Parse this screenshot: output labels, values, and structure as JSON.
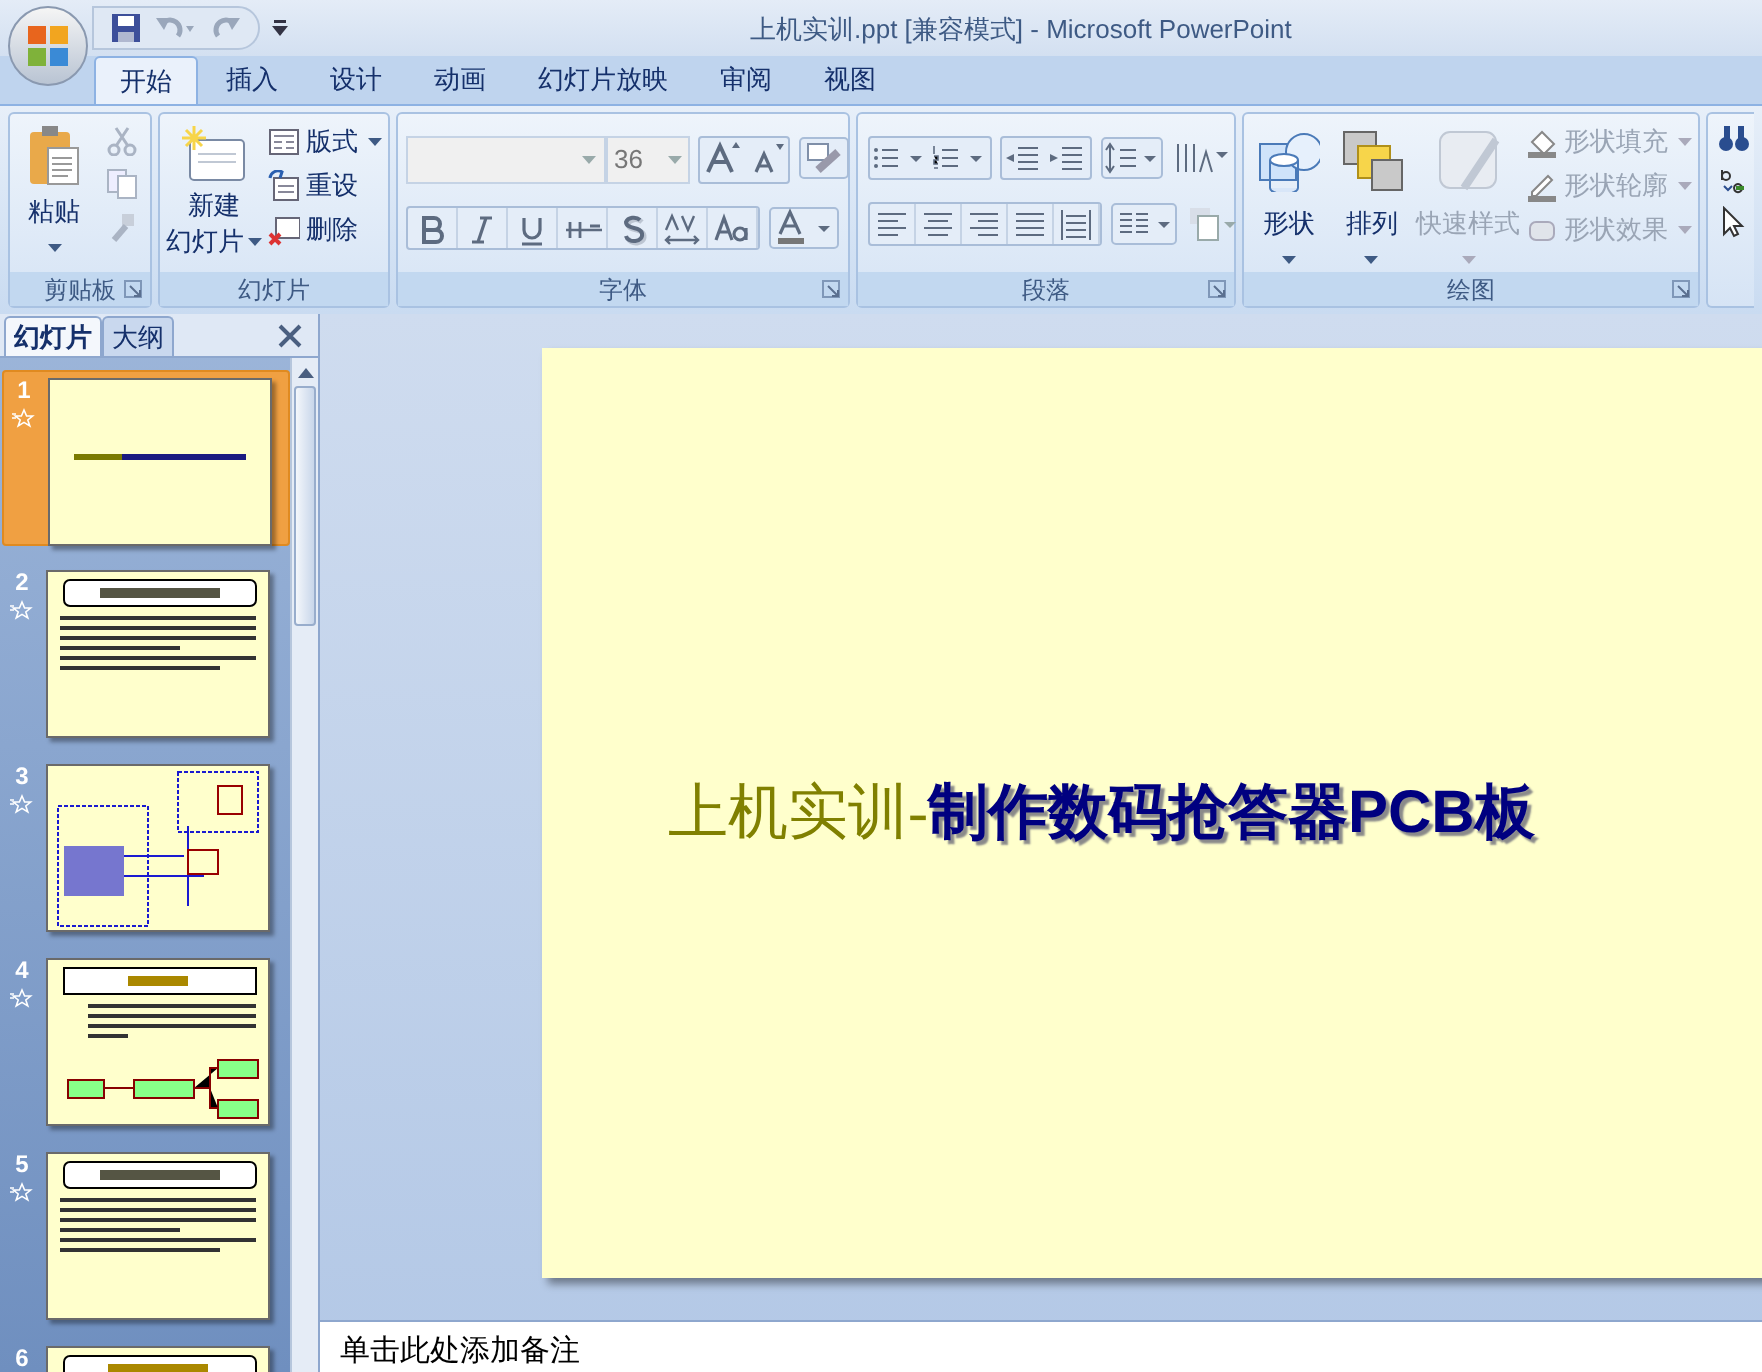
{
  "window": {
    "title": "上机实训.ppt [兼容模式] - Microsoft PowerPoint"
  },
  "tabs": [
    {
      "label": "开始",
      "selected": true
    },
    {
      "label": "插入",
      "selected": false
    },
    {
      "label": "设计",
      "selected": false
    },
    {
      "label": "动画",
      "selected": false
    },
    {
      "label": "幻灯片放映",
      "selected": false
    },
    {
      "label": "审阅",
      "selected": false
    },
    {
      "label": "视图",
      "selected": false
    }
  ],
  "ribbon": {
    "clipboard": {
      "label": "剪贴板",
      "paste": "粘贴"
    },
    "slides": {
      "label": "幻灯片",
      "new_slide": [
        "新建",
        "幻灯片"
      ],
      "items": [
        {
          "label": "版式",
          "dropdown": true
        },
        {
          "label": "重设",
          "dropdown": false
        },
        {
          "label": "删除",
          "dropdown": false
        }
      ]
    },
    "font": {
      "label": "字体",
      "size": "36"
    },
    "paragraph": {
      "label": "段落"
    },
    "drawing": {
      "label": "绘图",
      "big": [
        {
          "label": "形状",
          "disabled": false
        },
        {
          "label": "排列",
          "disabled": false
        },
        {
          "label": "快速样式",
          "disabled": true
        }
      ],
      "items": [
        {
          "label": "形状填充",
          "disabled": true
        },
        {
          "label": "形状轮廓",
          "disabled": true
        },
        {
          "label": "形状效果",
          "disabled": true
        }
      ]
    }
  },
  "panel": {
    "tabs": [
      {
        "label": "幻灯片",
        "selected": true
      },
      {
        "label": "大纲",
        "selected": false
      }
    ],
    "slides": [
      {
        "number": "1",
        "selected": true,
        "kind": "title"
      },
      {
        "number": "2",
        "selected": false,
        "kind": "text"
      },
      {
        "number": "3",
        "selected": false,
        "kind": "circuit"
      },
      {
        "number": "4",
        "selected": false,
        "kind": "blocks"
      },
      {
        "number": "5",
        "selected": false,
        "kind": "text"
      },
      {
        "number": "6",
        "selected": false,
        "kind": "title_only"
      }
    ]
  },
  "slide": {
    "title_plain": "上机实训-",
    "title_bold": "制作数码抢答器PCB板"
  },
  "notes": {
    "placeholder": "单击此处添加备注"
  }
}
